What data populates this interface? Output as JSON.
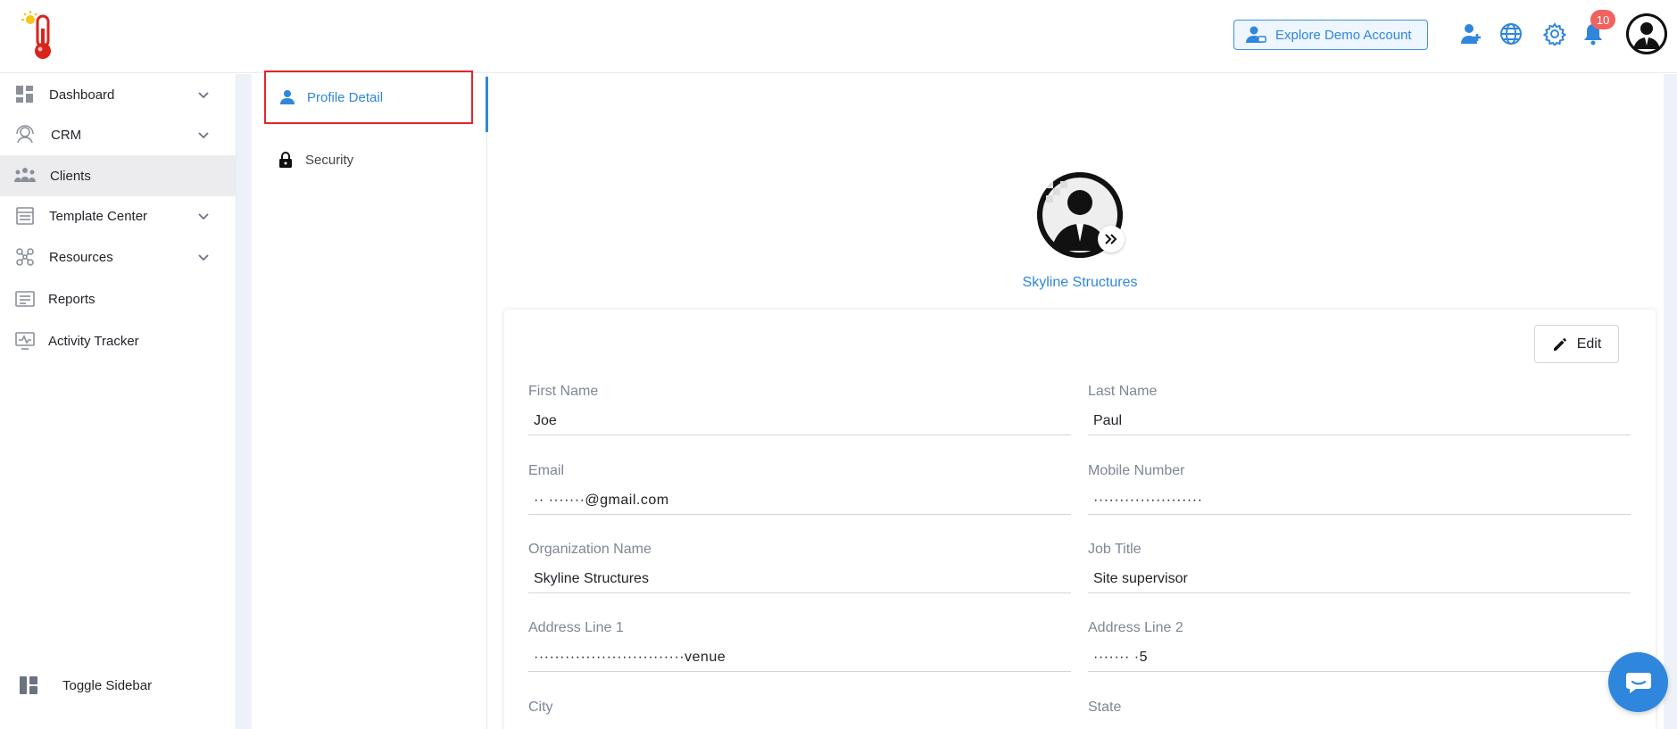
{
  "header": {
    "demo_button_label": "Explore Demo Account",
    "notification_count": "10"
  },
  "sidebar": {
    "items": [
      {
        "label": "Dashboard"
      },
      {
        "label": "CRM"
      },
      {
        "label": "Clients"
      },
      {
        "label": "Template Center"
      },
      {
        "label": "Resources"
      },
      {
        "label": "Reports"
      },
      {
        "label": "Activity Tracker"
      }
    ],
    "toggle_label": "Toggle Sidebar"
  },
  "tabs": [
    {
      "label": "Profile Detail"
    },
    {
      "label": "Security"
    }
  ],
  "profile": {
    "company_name": "Skyline Structures",
    "edit_label": "Edit",
    "fields": [
      {
        "label": "First Name",
        "value": "Joe"
      },
      {
        "label": "Last Name",
        "value": "Paul"
      },
      {
        "label": "Email",
        "value": "·· ·······@gmail.com"
      },
      {
        "label": "Mobile Number",
        "value": "·····················"
      },
      {
        "label": "Organization Name",
        "value": "Skyline Structures"
      },
      {
        "label": "Job Title",
        "value": "Site supervisor"
      },
      {
        "label": "Address Line 1",
        "value": "·····························venue"
      },
      {
        "label": "Address Line 2",
        "value": "······· ·5"
      },
      {
        "label": "City",
        "value": ""
      },
      {
        "label": "State",
        "value": ""
      }
    ]
  },
  "colors": {
    "accent": "#2f86dd",
    "active_outline": "#e0272b",
    "badge": "#f0625f",
    "active_nav_bg": "#ececee"
  }
}
